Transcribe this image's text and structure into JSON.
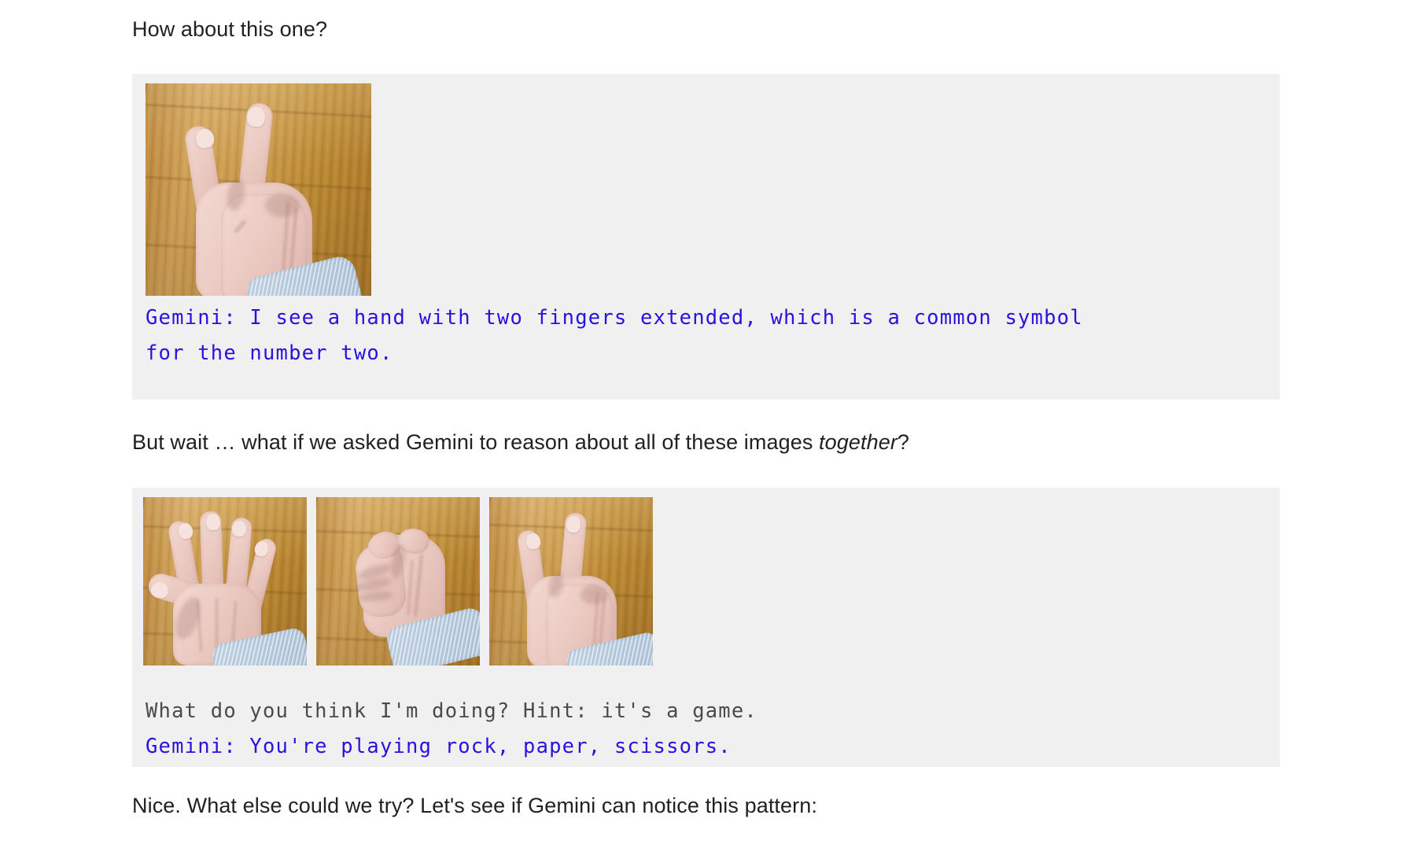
{
  "document": {
    "paragraphs": {
      "intro": "How about this one?",
      "middle_before_em": "But wait … what if we asked Gemini to reason about all of these images ",
      "middle_em": "together",
      "middle_after_em": "?",
      "outro": "Nice. What else could we try? Let's see if Gemini can notice this pattern:"
    },
    "blocks": [
      {
        "name": "single-image-example",
        "images": [
          {
            "alt": "hand with two fingers extended on a wooden table",
            "gesture": "scissors"
          }
        ],
        "lines": [
          {
            "speaker": "Gemini",
            "style": "gemini",
            "text_line_1": "Gemini: I see a hand with two fingers extended, which is a common symbol",
            "text_line_2": "for the number two."
          }
        ]
      },
      {
        "name": "multi-image-example",
        "images": [
          {
            "alt": "open palm hand on a wooden table",
            "gesture": "paper"
          },
          {
            "alt": "closed fist on a wooden table",
            "gesture": "rock"
          },
          {
            "alt": "hand with two fingers extended on a wooden table",
            "gesture": "scissors"
          }
        ],
        "lines": [
          {
            "speaker": "User",
            "style": "prompt",
            "text": "What do you think I'm doing? Hint: it's a game."
          },
          {
            "speaker": "Gemini",
            "style": "gemini",
            "text": "Gemini: You're playing rock, paper, scissors."
          }
        ]
      }
    ]
  },
  "colors": {
    "page_background": "#ffffff",
    "block_background": "#f0f0f0",
    "body_text": "#212121",
    "gemini_text": "#2911e0",
    "prompt_text": "#4a4a4a"
  }
}
